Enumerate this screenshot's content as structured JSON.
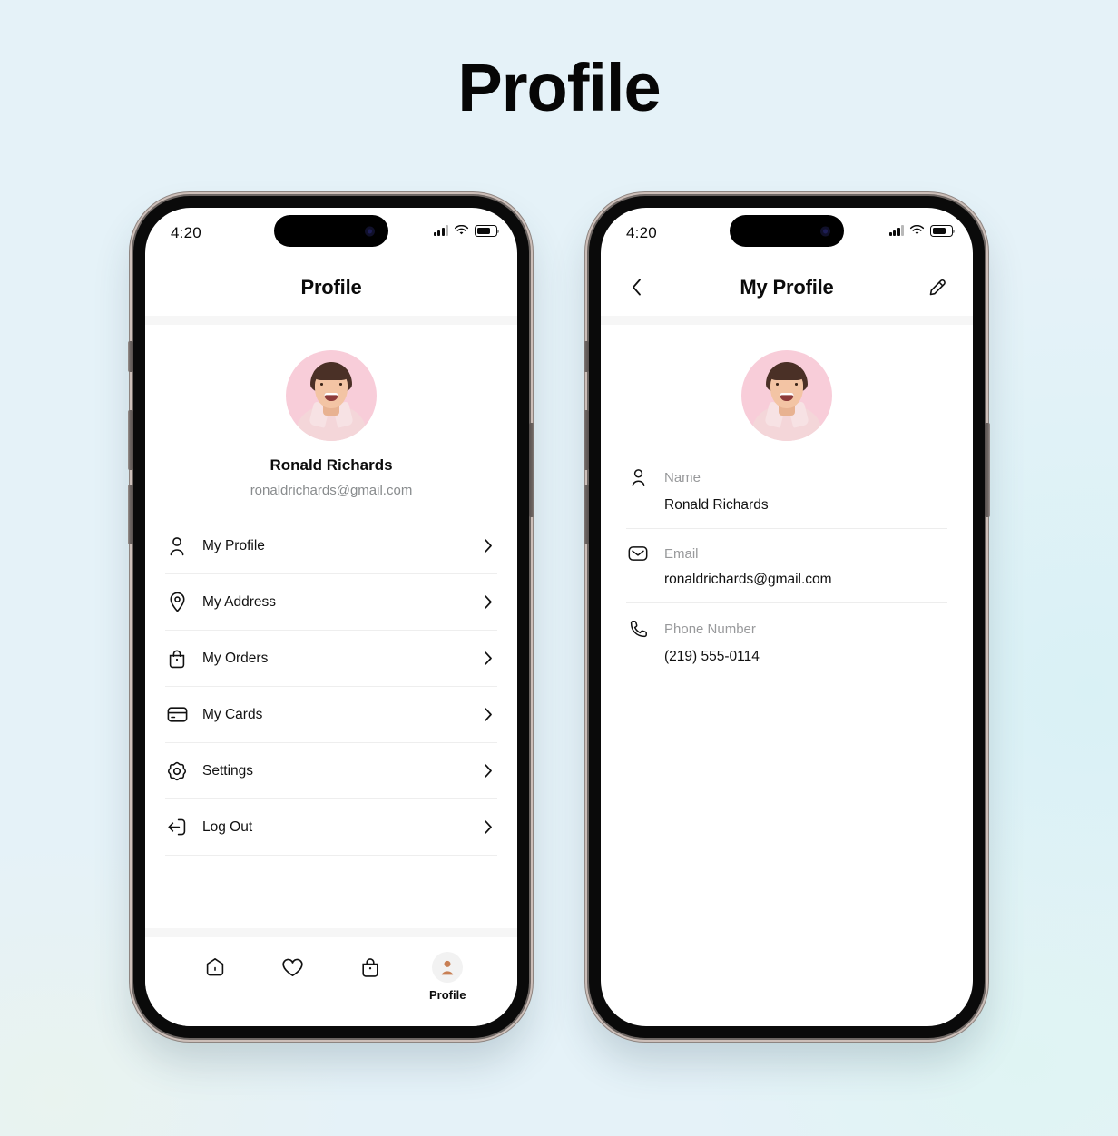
{
  "page": {
    "title": "Profile",
    "background_color": "#e5f2f8"
  },
  "phone_1": {
    "status_bar": {
      "time": "4:20",
      "signal_icon": "cellular-signal-icon",
      "wifi_icon": "wifi-icon",
      "battery_icon": "battery-icon"
    },
    "header": {
      "title": "Profile"
    },
    "profile": {
      "avatar_alt": "user-avatar",
      "name": "Ronald Richards",
      "email": "ronaldrichards@gmail.com"
    },
    "menu": [
      {
        "label": "My Profile",
        "icon": "person-icon",
        "chevron": "chevron-right-icon"
      },
      {
        "label": "My Address",
        "icon": "location-pin-icon",
        "chevron": "chevron-right-icon"
      },
      {
        "label": "My Orders",
        "icon": "shopping-bag-icon",
        "chevron": "chevron-right-icon"
      },
      {
        "label": "My Cards",
        "icon": "credit-card-icon",
        "chevron": "chevron-right-icon"
      },
      {
        "label": "Settings",
        "icon": "gear-icon",
        "chevron": "chevron-right-icon"
      },
      {
        "label": "Log Out",
        "icon": "logout-icon",
        "chevron": "chevron-right-icon"
      }
    ],
    "tabbar": [
      {
        "label": "",
        "icon": "home-icon",
        "active": false
      },
      {
        "label": "",
        "icon": "heart-icon",
        "active": false
      },
      {
        "label": "",
        "icon": "shopping-bag-icon",
        "active": false
      },
      {
        "label": "Profile",
        "icon": "profile-avatar-icon",
        "active": true
      }
    ]
  },
  "phone_2": {
    "status_bar": {
      "time": "4:20",
      "signal_icon": "cellular-signal-icon",
      "wifi_icon": "wifi-icon",
      "battery_icon": "battery-icon"
    },
    "header": {
      "back_icon": "chevron-left-icon",
      "title": "My Profile",
      "edit_icon": "pencil-edit-icon"
    },
    "profile": {
      "avatar_alt": "user-avatar"
    },
    "fields": [
      {
        "label": "Name",
        "value": "Ronald Richards",
        "icon": "person-icon"
      },
      {
        "label": "Email",
        "value": "ronaldrichards@gmail.com",
        "icon": "envelope-icon"
      },
      {
        "label": "Phone Number",
        "value": "(219) 555-0114",
        "icon": "phone-icon"
      }
    ]
  },
  "colors": {
    "accent_pink": "#f8cdd9",
    "text_primary": "#0b0b0b",
    "text_muted": "#98999b",
    "divider": "#ededed",
    "tab_avatar_bg": "#f2f2f2",
    "tab_avatar_fg": "#c87f54"
  }
}
